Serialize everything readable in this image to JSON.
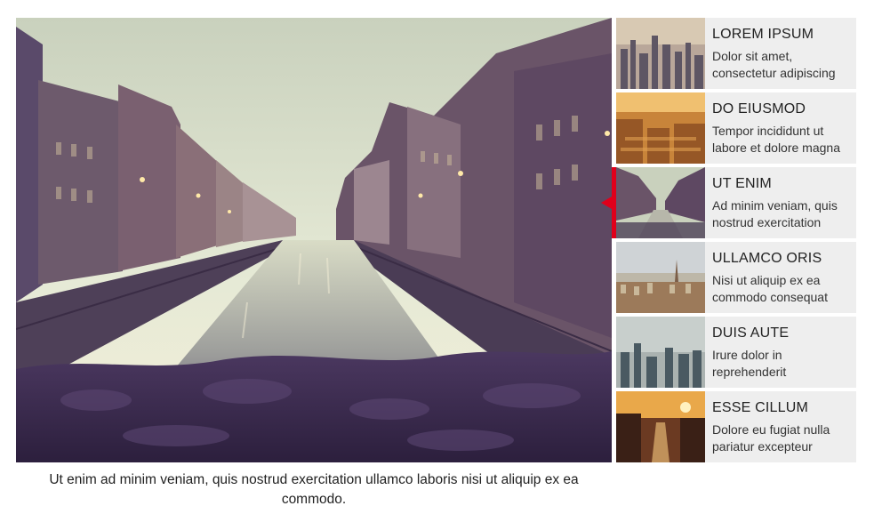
{
  "main": {
    "caption": "Ut enim ad minim veniam, quis nostrud exercitation ullamco laboris nisi ut aliquip ex ea commodo."
  },
  "thumbs": [
    {
      "title": "LOREM IPSUM",
      "desc": "Dolor sit amet, consectetur adipiscing",
      "active": false
    },
    {
      "title": "DO EIUSMOD",
      "desc": "Tempor incididunt ut labore et dolore magna",
      "active": false
    },
    {
      "title": "UT ENIM",
      "desc": "Ad minim veniam, quis nostrud exercitation",
      "active": true
    },
    {
      "title": "ULLAMCO ORIS",
      "desc": "Nisi ut aliquip ex ea commodo consequat",
      "active": false
    },
    {
      "title": "DUIS AUTE",
      "desc": "Irure dolor in reprehenderit",
      "active": false
    },
    {
      "title": "ESSE CILLUM",
      "desc": "Dolore eu fugiat nulla pariatur excepteur",
      "active": false
    }
  ],
  "colors": {
    "active_indicator": "#e0001b",
    "thumb_background": "#eeeeee"
  }
}
